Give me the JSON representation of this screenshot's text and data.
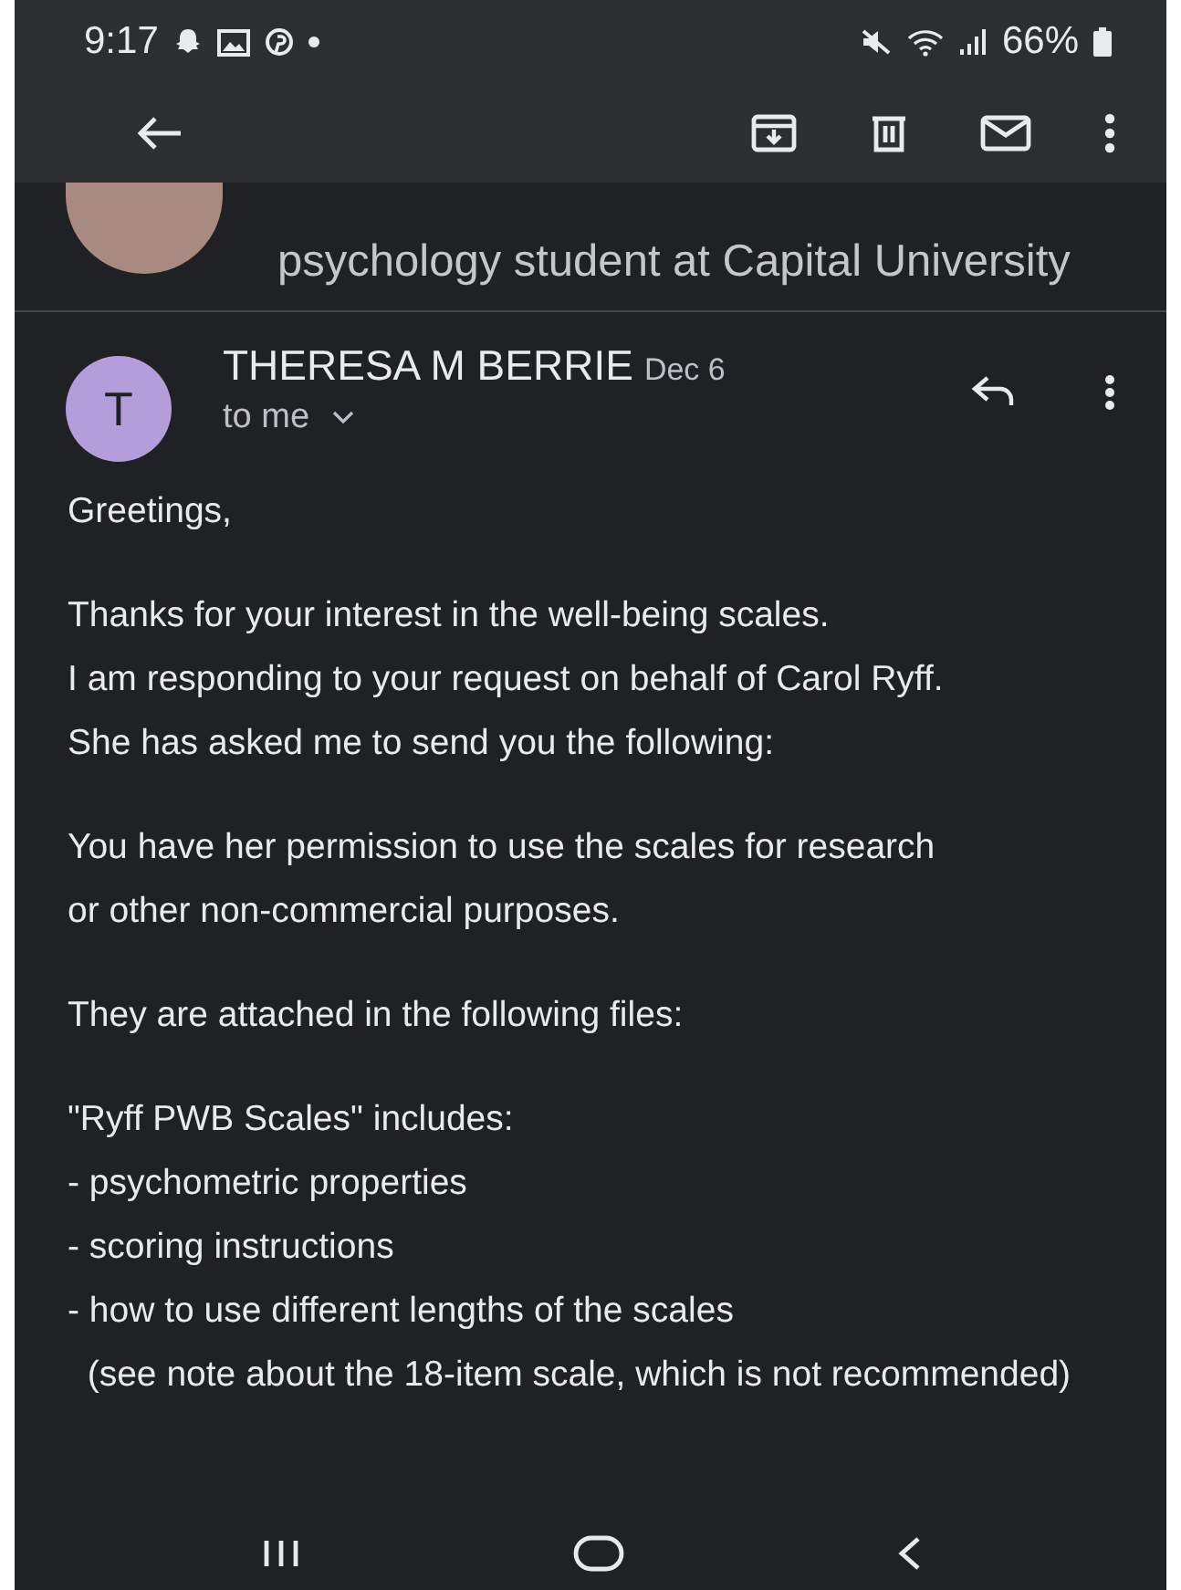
{
  "status_bar": {
    "time": "9:17",
    "battery": "66%"
  },
  "previous_message": {
    "snippet": "psychology student at Capital University"
  },
  "message": {
    "sender": "THERESA M BERRIE",
    "date": "Dec 6",
    "avatar_letter": "T",
    "recipient": "to me",
    "paragraphs": [
      [
        "Greetings,"
      ],
      [
        "Thanks for your interest in the well-being scales.",
        "I am responding to your request on behalf of Carol Ryff.",
        "She has asked me to send you the following:"
      ],
      [
        "You have her permission to use the scales for research",
        "or other non-commercial purposes."
      ],
      [
        "They are attached in the following files:"
      ],
      [
        "\"Ryff PWB Scales\" includes:",
        "- psychometric properties",
        "- scoring instructions",
        "- how to use different lengths of the scales",
        "  (see note about the 18-item scale, which is not recommended)"
      ]
    ]
  }
}
